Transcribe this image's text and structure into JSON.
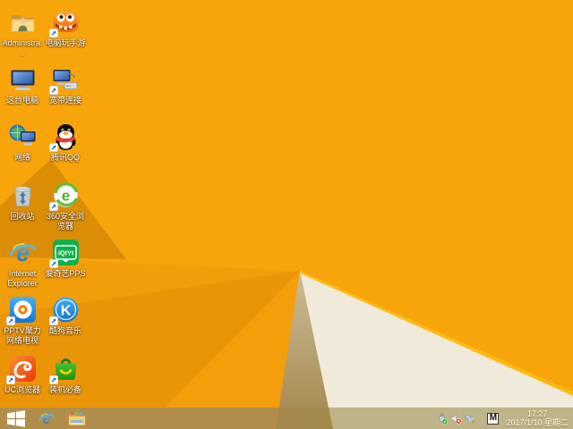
{
  "wallpaper": {
    "base": "#F8A50C",
    "fold_light": "#F29D0A",
    "fold_mid": "#EA9408",
    "fold_bright": "#F49E0B",
    "corner_dark": "#DC8D08",
    "tan_light": "#CBBC96",
    "tan_dark": "#A2864C",
    "cream": "#F0EADA",
    "accent_line": "#FFBA12",
    "taskbar_over_orange": "#B08D4A",
    "taskbar_over_tan": "#A3894C",
    "taskbar_over_cream": "#BFB488"
  },
  "desktop": {
    "icons": [
      {
        "id": "administrator",
        "label": "Administra...",
        "type": "user-folder",
        "shortcut": false,
        "col": 0,
        "row": 0
      },
      {
        "id": "pc-play-mobile-games",
        "label": "电脑玩手游",
        "type": "monster",
        "shortcut": true,
        "col": 1,
        "row": 0
      },
      {
        "id": "this-pc",
        "label": "这台电脑",
        "type": "computer",
        "shortcut": false,
        "col": 0,
        "row": 1
      },
      {
        "id": "broadband-connection",
        "label": "宽带连接",
        "type": "broadband",
        "shortcut": true,
        "col": 1,
        "row": 1
      },
      {
        "id": "network",
        "label": "网络",
        "type": "network",
        "shortcut": false,
        "col": 0,
        "row": 2
      },
      {
        "id": "tencent-qq",
        "label": "腾讯QQ",
        "type": "qq",
        "shortcut": true,
        "col": 1,
        "row": 2
      },
      {
        "id": "recycle-bin",
        "label": "回收站",
        "type": "recycle",
        "shortcut": false,
        "col": 0,
        "row": 3
      },
      {
        "id": "360-safe-browser",
        "label": "360安全浏览器",
        "type": "se360",
        "shortcut": true,
        "col": 1,
        "row": 3
      },
      {
        "id": "internet-explorer",
        "label": "Internet Explorer",
        "type": "ie",
        "shortcut": false,
        "col": 0,
        "row": 4
      },
      {
        "id": "iqiyi-pps",
        "label": "爱奇艺PPS",
        "type": "iqiyi",
        "shortcut": true,
        "col": 1,
        "row": 4
      },
      {
        "id": "pptv",
        "label": "PPTV聚力 网络电视",
        "type": "pptv",
        "shortcut": true,
        "col": 0,
        "row": 5
      },
      {
        "id": "kugou-music",
        "label": "酷狗音乐",
        "type": "kugou",
        "shortcut": true,
        "col": 1,
        "row": 5
      },
      {
        "id": "uc-browser",
        "label": "UC浏览器",
        "type": "uc",
        "shortcut": true,
        "col": 0,
        "row": 6
      },
      {
        "id": "zhuangji-bibei",
        "label": "装机必备",
        "type": "bag",
        "shortcut": true,
        "col": 1,
        "row": 6
      }
    ]
  },
  "taskbar": {
    "tray": {
      "ime_label": "M",
      "time": "17:27",
      "date": "2017/1/10 星期二"
    }
  }
}
